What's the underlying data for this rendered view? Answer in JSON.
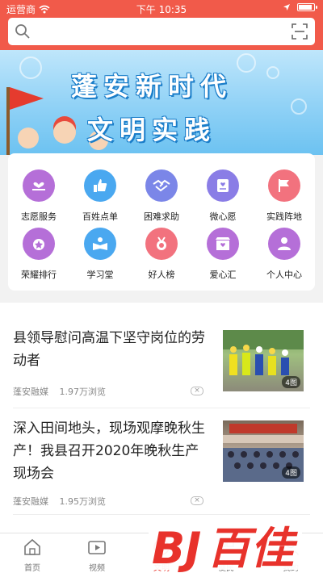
{
  "status_bar": {
    "carrier": "运营商",
    "time": "下午 10:35"
  },
  "search": {
    "placeholder": ""
  },
  "banner": {
    "line1": "蓬安新时代",
    "line2": "文明实践"
  },
  "grid": [
    {
      "label": "志愿服务",
      "color": "#b56fd8",
      "icon": "heart-hand-icon"
    },
    {
      "label": "百姓点单",
      "color": "#4aa8f0",
      "icon": "thumbs-up-icon"
    },
    {
      "label": "困难求助",
      "color": "#7b86e8",
      "icon": "handshake-icon"
    },
    {
      "label": "微心愿",
      "color": "#8a7de6",
      "icon": "wish-card-icon"
    },
    {
      "label": "实践阵地",
      "color": "#f2727e",
      "icon": "flag-icon"
    },
    {
      "label": "荣耀排行",
      "color": "#b56fd8",
      "icon": "medal-icon"
    },
    {
      "label": "学习堂",
      "color": "#4aa8f0",
      "icon": "book-reader-icon"
    },
    {
      "label": "好人榜",
      "color": "#f2727e",
      "icon": "ribbon-medal-icon"
    },
    {
      "label": "爱心汇",
      "color": "#b56fd8",
      "icon": "heart-shop-icon"
    },
    {
      "label": "个人中心",
      "color": "#b56fd8",
      "icon": "person-icon"
    }
  ],
  "news": [
    {
      "title": "县领导慰问高温下坚守岗位的劳动者",
      "source": "蓬安融媒",
      "views": "1.97万浏览",
      "image_count": "4图"
    },
    {
      "title": "深入田间地头，现场观摩晚秋生产！我县召开2020年晚秋生产现场会",
      "source": "蓬安融媒",
      "views": "1.95万浏览",
      "image_count": "4图"
    }
  ],
  "tabs": [
    {
      "label": "首页",
      "icon": "home-icon"
    },
    {
      "label": "视频",
      "icon": "video-icon"
    },
    {
      "label": "文明",
      "icon": "civilization-icon"
    },
    {
      "label": "便民",
      "icon": "service-icon"
    },
    {
      "label": "我的",
      "icon": "profile-icon"
    }
  ],
  "watermark": {
    "text": "百佳",
    "mark": "BJ"
  },
  "colors": {
    "header": "#f15a4a",
    "accent": "#e9392f",
    "logo": "#e8322b"
  }
}
